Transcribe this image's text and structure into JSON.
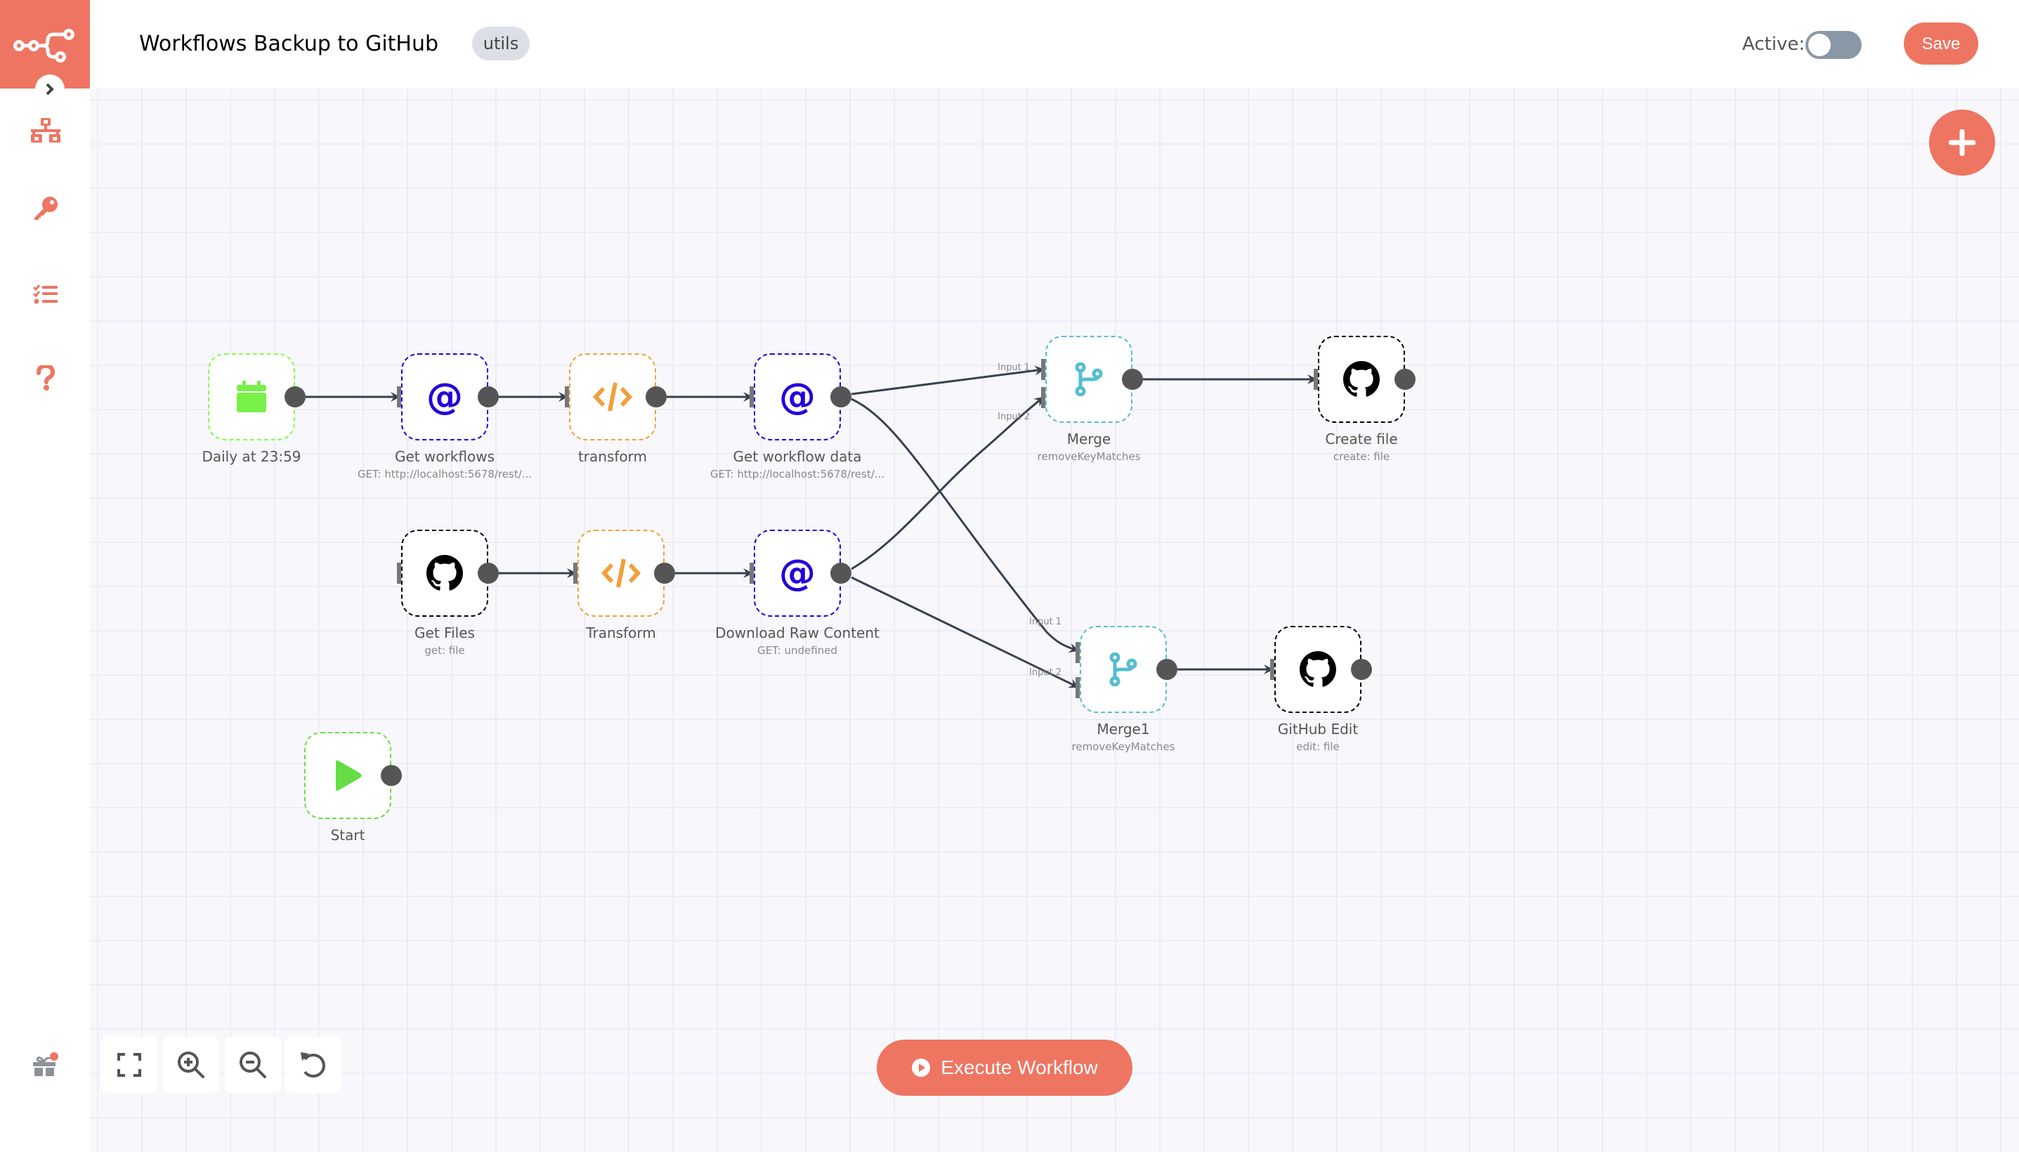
{
  "header": {
    "title": "Workflows Backup to GitHub",
    "tag": "utils",
    "active_label": "Active:",
    "active": false,
    "save_label": "Save"
  },
  "brand": {
    "accent": "#ee7561"
  },
  "sidebar": {
    "items": [
      {
        "icon": "network-icon",
        "label": "Workflows"
      },
      {
        "icon": "key-icon",
        "label": "Credentials"
      },
      {
        "icon": "tasks-icon",
        "label": "Executions"
      },
      {
        "icon": "question-icon",
        "label": "Help"
      }
    ],
    "footer_icon": "gift-icon"
  },
  "nodes": [
    {
      "id": "daily",
      "name": "Daily at 23:59",
      "subtitle": "",
      "type": "cron",
      "color": "#7fff47"
    },
    {
      "id": "get-workflows",
      "name": "Get workflows",
      "subtitle": "GET: http://localhost:5678/rest/...",
      "type": "http",
      "color": "#2200dd"
    },
    {
      "id": "transform",
      "name": "transform",
      "subtitle": "",
      "type": "function",
      "color": "#f0a03c"
    },
    {
      "id": "get-workflow-data",
      "name": "Get workflow data",
      "subtitle": "GET: http://localhost:5678/rest/...",
      "type": "http",
      "color": "#2200dd"
    },
    {
      "id": "merge",
      "name": "Merge",
      "subtitle": "removeKeyMatches",
      "type": "merge",
      "color": "#56bdd0"
    },
    {
      "id": "create-file",
      "name": "Create file",
      "subtitle": "create: file",
      "type": "github",
      "color": "#000000"
    },
    {
      "id": "get-files",
      "name": "Get Files",
      "subtitle": "get: file",
      "type": "github",
      "color": "#000000"
    },
    {
      "id": "transform2",
      "name": "Transform",
      "subtitle": "",
      "type": "function",
      "color": "#f0a03c"
    },
    {
      "id": "download-raw",
      "name": "Download Raw Content",
      "subtitle": "GET: undefined",
      "type": "http",
      "color": "#2200dd"
    },
    {
      "id": "merge1",
      "name": "Merge1",
      "subtitle": "removeKeyMatches",
      "type": "merge",
      "color": "#56bdd0"
    },
    {
      "id": "github-edit",
      "name": "GitHub Edit",
      "subtitle": "edit: file",
      "type": "github",
      "color": "#000000"
    },
    {
      "id": "start",
      "name": "Start",
      "subtitle": "",
      "type": "start",
      "color": "#66dd44"
    }
  ],
  "connections": [
    {
      "from": "Daily at 23:59",
      "to": "Get workflows"
    },
    {
      "from": "Get workflows",
      "to": "transform"
    },
    {
      "from": "transform",
      "to": "Get workflow data"
    },
    {
      "from": "Get workflow data",
      "to": "Merge",
      "input": "Input 1"
    },
    {
      "from": "Get workflow data",
      "to": "Merge1",
      "input": "Input 1"
    },
    {
      "from": "Download Raw Content",
      "to": "Merge",
      "input": "Input 2"
    },
    {
      "from": "Download Raw Content",
      "to": "Merge1",
      "input": "Input 2"
    },
    {
      "from": "Merge",
      "to": "Create file"
    },
    {
      "from": "Get Files",
      "to": "Transform"
    },
    {
      "from": "Transform",
      "to": "Download Raw Content"
    },
    {
      "from": "Merge1",
      "to": "GitHub Edit"
    }
  ],
  "input_labels": {
    "input1": "Input 1",
    "input2": "Input 2"
  },
  "canvas_controls": [
    {
      "icon": "fullscreen-icon",
      "label": "Zoom to fit"
    },
    {
      "icon": "zoom-in-icon",
      "label": "Zoom in"
    },
    {
      "icon": "zoom-out-icon",
      "label": "Zoom out"
    },
    {
      "icon": "reset-icon",
      "label": "Reset zoom"
    }
  ],
  "execute_label": "Execute Workflow"
}
